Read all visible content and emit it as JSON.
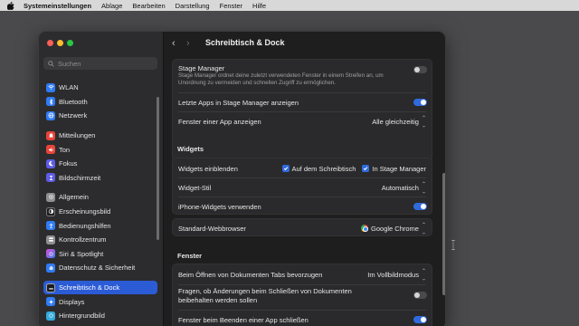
{
  "menubar": {
    "app": "Systemeinstellungen",
    "items": [
      "Ablage",
      "Bearbeiten",
      "Darstellung",
      "Fenster",
      "Hilfe"
    ]
  },
  "sidebar": {
    "search_placeholder": "Suchen",
    "items": [
      {
        "label": "WLAN",
        "icon": "wifi-icon",
        "color": "#2f7bf5"
      },
      {
        "label": "Bluetooth",
        "icon": "bluetooth-icon",
        "color": "#2f7bf5"
      },
      {
        "label": "Netzwerk",
        "icon": "globe-icon",
        "color": "#2f7bf5"
      },
      {
        "label": "Mitteilungen",
        "icon": "bell-icon",
        "color": "#e8443a"
      },
      {
        "label": "Ton",
        "icon": "speaker-icon",
        "color": "#e8443a"
      },
      {
        "label": "Fokus",
        "icon": "moon-icon",
        "color": "#5e5ce6"
      },
      {
        "label": "Bildschirmzeit",
        "icon": "hourglass-icon",
        "color": "#5e5ce6"
      },
      {
        "label": "Allgemein",
        "icon": "gear-icon",
        "color": "#8e8e93"
      },
      {
        "label": "Erscheinungsbild",
        "icon": "appearance-icon",
        "color": "#1c1c1e"
      },
      {
        "label": "Bedienungshilfen",
        "icon": "accessibility-icon",
        "color": "#2f7bf5"
      },
      {
        "label": "Kontrollzentrum",
        "icon": "control-center-icon",
        "color": "#8e8e93"
      },
      {
        "label": "Siri & Spotlight",
        "icon": "siri-icon",
        "color": "#b04be0"
      },
      {
        "label": "Datenschutz & Sicherheit",
        "icon": "hand-icon",
        "color": "#2f7bf5"
      },
      {
        "label": "Schreibtisch & Dock",
        "icon": "dock-icon",
        "color": "#1c1c1e",
        "selected": true
      },
      {
        "label": "Displays",
        "icon": "display-icon",
        "color": "#2f7bf5"
      },
      {
        "label": "Hintergrundbild",
        "icon": "wallpaper-icon",
        "color": "#34aadc"
      }
    ]
  },
  "main": {
    "title": "Schreibtisch & Dock",
    "stage_manager": {
      "label": "Stage Manager",
      "description_line1": "Stage Manager ordnet deine zuletzt verwendeten Fenster in einem Streifen an, um",
      "description_line2": "Unordnung zu vermeiden und schnellen Zugriff zu ermöglichen.",
      "enabled": false
    },
    "recent_apps": {
      "label": "Letzte Apps in Stage Manager anzeigen",
      "enabled": true
    },
    "window_of_app": {
      "label": "Fenster einer App anzeigen",
      "value": "Alle gleichzeitig"
    },
    "widgets_heading": "Widgets",
    "widgets_show": {
      "label": "Widgets einblenden",
      "option1": "Auf dem Schreibtisch",
      "option2": "In Stage Manager"
    },
    "widget_style": {
      "label": "Widget-Stil",
      "value": "Automatisch"
    },
    "iphone_widgets": {
      "label": "iPhone-Widgets verwenden",
      "enabled": true
    },
    "default_browser": {
      "label": "Standard-Webbrowser",
      "value": "Google Chrome"
    },
    "windows_heading": "Fenster",
    "prefer_tabs": {
      "label": "Beim Öffnen von Dokumenten Tabs bevorzugen",
      "value": "Im Vollbildmodus"
    },
    "ask_keep_changes": {
      "label_line1": "Fragen, ob Änderungen beim Schließen von Dokumenten",
      "label_line2": "beibehalten werden sollen",
      "enabled": false
    },
    "close_windows_on_quit": {
      "label": "Fenster beim Beenden einer App schließen",
      "enabled": true
    }
  }
}
